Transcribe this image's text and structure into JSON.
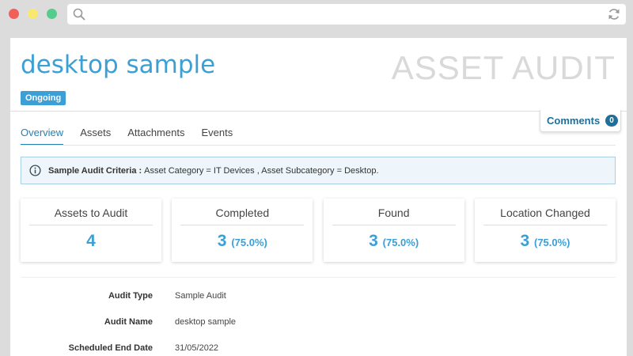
{
  "page": {
    "title": "desktop sample",
    "watermark": "ASSET AUDIT",
    "status_badge": "Ongoing",
    "comments": {
      "label": "Comments",
      "count": "0"
    }
  },
  "tabs": [
    {
      "label": "Overview",
      "active": true
    },
    {
      "label": "Assets",
      "active": false
    },
    {
      "label": "Attachments",
      "active": false
    },
    {
      "label": "Events",
      "active": false
    }
  ],
  "criteria": {
    "label": "Sample Audit Criteria :",
    "text": "Asset Category = IT Devices , Asset Subcategory = Desktop."
  },
  "stats": [
    {
      "label": "Assets to Audit",
      "value": "4",
      "pct": ""
    },
    {
      "label": "Completed",
      "value": "3",
      "pct": "(75.0%)"
    },
    {
      "label": "Found",
      "value": "3",
      "pct": "(75.0%)"
    },
    {
      "label": "Location Changed",
      "value": "3",
      "pct": "(75.0%)"
    }
  ],
  "details": [
    {
      "key": "Audit Type",
      "value": "Sample Audit"
    },
    {
      "key": "Audit Name",
      "value": "desktop sample"
    },
    {
      "key": "Scheduled End Date",
      "value": "31/05/2022"
    }
  ],
  "icons": {
    "search": "search-icon",
    "refresh": "refresh-icon",
    "info": "info-icon"
  },
  "colors": {
    "accent": "#3c9fd6",
    "accent_dark": "#1f6f9a",
    "criteria_bg": "#eef6fb"
  }
}
